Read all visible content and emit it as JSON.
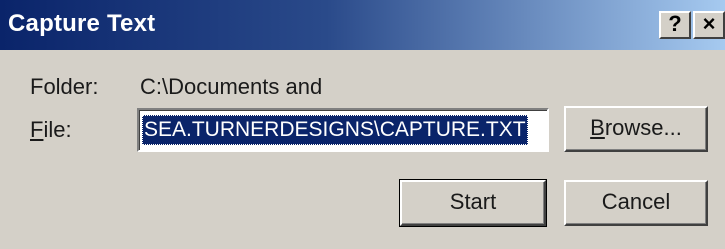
{
  "window": {
    "title": "Capture Text",
    "help_label": "?",
    "close_label": "×"
  },
  "folder": {
    "label": "Folder:",
    "value": "C:\\Documents and"
  },
  "file": {
    "label_mnemonic": "F",
    "label_rest": "ile:",
    "value": "SEA.TURNERDESIGNS\\CAPTURE.TXT"
  },
  "buttons": {
    "browse_mnemonic": "B",
    "browse_rest": "rowse...",
    "start": "Start",
    "cancel": "Cancel"
  },
  "colors": {
    "title_bar_start": "#0a246a",
    "title_bar_end": "#a6caf0",
    "selection": "#0a246a",
    "face": "#d4d0c8"
  }
}
